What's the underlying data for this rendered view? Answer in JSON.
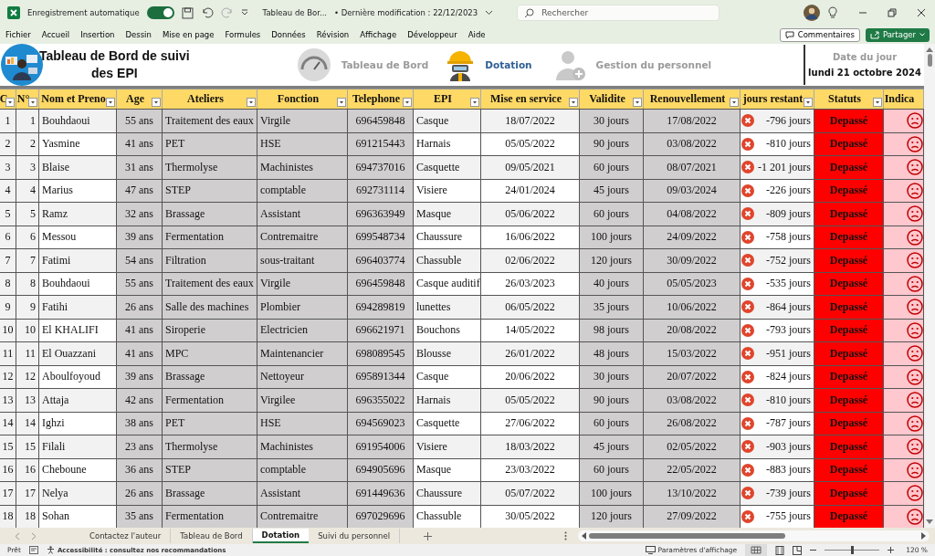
{
  "titlebar": {
    "autosave_label": "Enregistrement automatique",
    "autosave_on": true,
    "file_name": "Tableau de Bor...",
    "modified": "• Dernière modification : 22/12/2023",
    "search_placeholder": "Rechercher"
  },
  "menu": {
    "items": [
      "Fichier",
      "Accueil",
      "Insertion",
      "Dessin",
      "Mise en page",
      "Formules",
      "Données",
      "Révision",
      "Affichage",
      "Développeur",
      "Aide"
    ],
    "comments": "Commentaires",
    "share": "Partager"
  },
  "banner": {
    "title_lines": [
      "Tableau de Bord de suivi",
      "des EPI"
    ],
    "nav": [
      {
        "label": "Tableau de Bord",
        "selected": false
      },
      {
        "label": "Dotation",
        "selected": true
      },
      {
        "label": "Gestion du personnel",
        "selected": false
      }
    ],
    "date_label": "Date du jour",
    "date_value": "lundi 21 octobre 2024"
  },
  "table": {
    "columns": [
      "C",
      "N°",
      "Nom et Preno",
      "Age",
      "Ateliers",
      "Fonction",
      "Telephone",
      "EPI",
      "Mise en service",
      "Validite",
      "Renouvellement",
      "jours restant",
      "Statuts",
      "Indica"
    ],
    "rows": [
      {
        "cells": [
          "1",
          "1",
          "Bouhdaoui",
          "55 ans",
          "Traitement des eaux",
          "Virgile",
          "696459848",
          "Casque",
          "18/07/2022",
          "30 jours",
          "17/08/2022",
          "-796 jours"
        ],
        "status": "Depassé"
      },
      {
        "cells": [
          "2",
          "2",
          "Yasmine",
          "41 ans",
          "PET",
          "HSE",
          "691215443",
          "Harnais",
          "05/05/2022",
          "90 jours",
          "03/08/2022",
          "-810 jours"
        ],
        "status": "Depassé"
      },
      {
        "cells": [
          "3",
          "3",
          "Blaise",
          "31 ans",
          "Thermolyse",
          "Machinistes",
          "694737016",
          "Casquette",
          "09/05/2021",
          "60 jours",
          "08/07/2021",
          "-1 201 jours"
        ],
        "status": "Depassé"
      },
      {
        "cells": [
          "4",
          "4",
          "Marius",
          "47 ans",
          "STEP",
          "comptable",
          "692731114",
          "Visiere",
          "24/01/2024",
          "45 jours",
          "09/03/2024",
          "-226 jours"
        ],
        "status": "Depassé"
      },
      {
        "cells": [
          "5",
          "5",
          "Ramz",
          "32 ans",
          "Brassage",
          "Assistant",
          "696363949",
          "Masque",
          "05/06/2022",
          "60 jours",
          "04/08/2022",
          "-809 jours"
        ],
        "status": "Depassé"
      },
      {
        "cells": [
          "6",
          "6",
          "Messou",
          "39 ans",
          "Fermentation",
          "Contremaitre",
          "699548734",
          "Chaussure",
          "16/06/2022",
          "100 jours",
          "24/09/2022",
          "-758 jours"
        ],
        "status": "Depassé"
      },
      {
        "cells": [
          "7",
          "7",
          "Fatimi",
          "54 ans",
          "Filtration",
          "sous-traitant",
          "696403774",
          "Chassuble",
          "02/06/2022",
          "120 jours",
          "30/09/2022",
          "-752 jours"
        ],
        "status": "Depassé"
      },
      {
        "cells": [
          "8",
          "8",
          "Bouhdaoui",
          "55 ans",
          "Traitement des eaux",
          "Virgile",
          "696459848",
          "Casque auditif",
          "26/03/2023",
          "40 jours",
          "05/05/2023",
          "-535 jours"
        ],
        "status": "Depassé"
      },
      {
        "cells": [
          "9",
          "9",
          "Fatihi",
          "26 ans",
          "Salle des machines",
          "Plombier",
          "694289819",
          "lunettes",
          "06/05/2022",
          "35 jours",
          "10/06/2022",
          "-864 jours"
        ],
        "status": "Depassé"
      },
      {
        "cells": [
          "10",
          "10",
          "El KHALIFI",
          "41 ans",
          "Siroperie",
          "Electricien",
          "696621971",
          "Bouchons",
          "14/05/2022",
          "98 jours",
          "20/08/2022",
          "-793 jours"
        ],
        "status": "Depassé"
      },
      {
        "cells": [
          "11",
          "11",
          "El Ouazzani",
          "41 ans",
          "MPC",
          "Maintenancier",
          "698089545",
          "Blousse",
          "26/01/2022",
          "48 jours",
          "15/03/2022",
          "-951 jours"
        ],
        "status": "Depassé"
      },
      {
        "cells": [
          "12",
          "12",
          "Aboulfoyoud",
          "39 ans",
          "Brassage",
          "Nettoyeur",
          "695891344",
          "Casque",
          "20/06/2022",
          "30 jours",
          "20/07/2022",
          "-824 jours"
        ],
        "status": "Depassé"
      },
      {
        "cells": [
          "13",
          "13",
          "Attaja",
          "42 ans",
          "Fermentation",
          "Virgilee",
          "696355022",
          "Harnais",
          "05/05/2022",
          "90 jours",
          "03/08/2022",
          "-810 jours"
        ],
        "status": "Depassé"
      },
      {
        "cells": [
          "14",
          "14",
          "Ighzi",
          "38 ans",
          "PET",
          "HSE",
          "694569023",
          "Casquette",
          "27/06/2022",
          "60 jours",
          "26/08/2022",
          "-787 jours"
        ],
        "status": "Depassé"
      },
      {
        "cells": [
          "15",
          "15",
          "Filali",
          "23 ans",
          "Thermolyse",
          "Machinistes",
          "691954006",
          "Visiere",
          "18/03/2022",
          "45 jours",
          "02/05/2022",
          "-903 jours"
        ],
        "status": "Depassé"
      },
      {
        "cells": [
          "16",
          "16",
          "Cheboune",
          "36 ans",
          "STEP",
          "comptable",
          "694905696",
          "Masque",
          "23/03/2022",
          "60 jours",
          "22/05/2022",
          "-883 jours"
        ],
        "status": "Depassé"
      },
      {
        "cells": [
          "17",
          "17",
          "Nelya",
          "26 ans",
          "Brassage",
          "Assistant",
          "691449636",
          "Chaussure",
          "05/07/2022",
          "100 jours",
          "13/10/2022",
          "-739 jours"
        ],
        "status": "Depassé"
      },
      {
        "cells": [
          "18",
          "18",
          "Sohan",
          "35 ans",
          "Fermentation",
          "Contremaitre",
          "697029696",
          "Chassuble",
          "30/05/2022",
          "120 jours",
          "27/09/2022",
          "-755 jours"
        ],
        "status": "Depassé"
      }
    ]
  },
  "sheet_tabs": [
    {
      "label": "Contactez l'auteur",
      "selected": false
    },
    {
      "label": "Tableau de Bord",
      "selected": false
    },
    {
      "label": "Dotation",
      "selected": true
    },
    {
      "label": "Suivi du personnel",
      "selected": false
    }
  ],
  "status_bar": {
    "ready": "Prêt",
    "accessibility": "Accessibilité : consultez nos recommandations",
    "display_settings": "Paramètres d'affichage",
    "zoom": {
      "level": 0.5,
      "reading": "120 %"
    }
  }
}
